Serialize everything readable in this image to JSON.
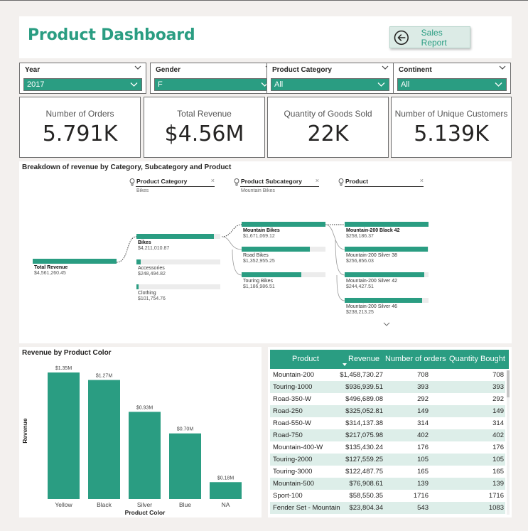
{
  "header": {
    "title": "Product Dashboard",
    "sales_button_label": "Sales Report"
  },
  "slicers": [
    {
      "title": "Year",
      "value": "2017"
    },
    {
      "title": "Gender",
      "value": "F"
    },
    {
      "title": "Product Category",
      "value": "All"
    },
    {
      "title": "Continent",
      "value": "All"
    }
  ],
  "kpis": [
    {
      "label": "Number of Orders",
      "value": "5.791K"
    },
    {
      "label": "Total Revenue",
      "value": "$4.56M"
    },
    {
      "label": "Quantity of Goods Sold",
      "value": "22K"
    },
    {
      "label": "Number of Unique Customers",
      "value": "5.139K"
    }
  ],
  "tree": {
    "title": "Breakdown of revenue by Category, Subcategory and Product",
    "levels": [
      {
        "name": "Product Category",
        "selected": "Bikes"
      },
      {
        "name": "Product Subcategory",
        "selected": "Mountain Bikes"
      },
      {
        "name": "Product",
        "selected": ""
      }
    ],
    "root": {
      "name": "Total Revenue",
      "value": "$4,561,260.45",
      "fraction": 1.0
    },
    "categories": [
      {
        "name": "Bikes",
        "value": "$4,211,010.87",
        "fraction": 0.923
      },
      {
        "name": "Accessories",
        "value": "$248,494.82",
        "fraction": 0.054
      },
      {
        "name": "Clothing",
        "value": "$101,754.76",
        "fraction": 0.022
      }
    ],
    "subcategories": [
      {
        "name": "Mountain Bikes",
        "value": "$1,671,069.12",
        "fraction": 1.0
      },
      {
        "name": "Road Bikes",
        "value": "$1,352,955.25",
        "fraction": 0.81
      },
      {
        "name": "Touring Bikes",
        "value": "$1,186,986.51",
        "fraction": 0.71
      }
    ],
    "products": [
      {
        "name": "Mountain-200 Black 42",
        "value": "$258,186.37",
        "fraction": 1.0
      },
      {
        "name": "Mountain-200 Silver 38",
        "value": "$256,856.03",
        "fraction": 0.995
      },
      {
        "name": "Mountain-200 Silver 42",
        "value": "$244,427.51",
        "fraction": 0.947
      },
      {
        "name": "Mountain-200 Silver 46",
        "value": "$238,213.25",
        "fraction": 0.923
      }
    ]
  },
  "color_chart": {
    "title": "Revenue by Product Color",
    "bar_color": "#2a9d82"
  },
  "chart_data": {
    "type": "bar",
    "title": "Revenue by Product Color",
    "xlabel": "Product Color",
    "ylabel": "Revenue",
    "categories": [
      "Yellow",
      "Black",
      "Silver",
      "Blue",
      "NA"
    ],
    "values": [
      1.35,
      1.27,
      0.93,
      0.7,
      0.18
    ],
    "data_labels": [
      "$1.35M",
      "$1.27M",
      "$0.93M",
      "$0.70M",
      "$0.18M"
    ],
    "ylim": [
      0,
      1.35
    ],
    "grid": false
  },
  "table": {
    "columns": [
      "Product",
      "Revenue",
      "Number of orders",
      "Quantity Bought"
    ],
    "rows": [
      [
        "Mountain-200",
        "$1,458,730.27",
        "708",
        "708"
      ],
      [
        "Touring-1000",
        "$936,939.51",
        "393",
        "393"
      ],
      [
        "Road-350-W",
        "$496,689.08",
        "292",
        "292"
      ],
      [
        "Road-250",
        "$325,052.81",
        "149",
        "149"
      ],
      [
        "Road-550-W",
        "$314,137.38",
        "314",
        "314"
      ],
      [
        "Road-750",
        "$217,075.98",
        "402",
        "402"
      ],
      [
        "Mountain-400-W",
        "$135,430.24",
        "176",
        "176"
      ],
      [
        "Touring-2000",
        "$127,559.25",
        "105",
        "105"
      ],
      [
        "Touring-3000",
        "$122,487.75",
        "165",
        "165"
      ],
      [
        "Mountain-500",
        "$76,908.61",
        "139",
        "139"
      ],
      [
        "Sport-100",
        "$58,550.35",
        "1716",
        "1716"
      ],
      [
        "Fender Set - Mountain",
        "$23,804.34",
        "543",
        "1083"
      ]
    ]
  },
  "colors": {
    "accent": "#2a9d82",
    "background": "#f3f0ee"
  }
}
